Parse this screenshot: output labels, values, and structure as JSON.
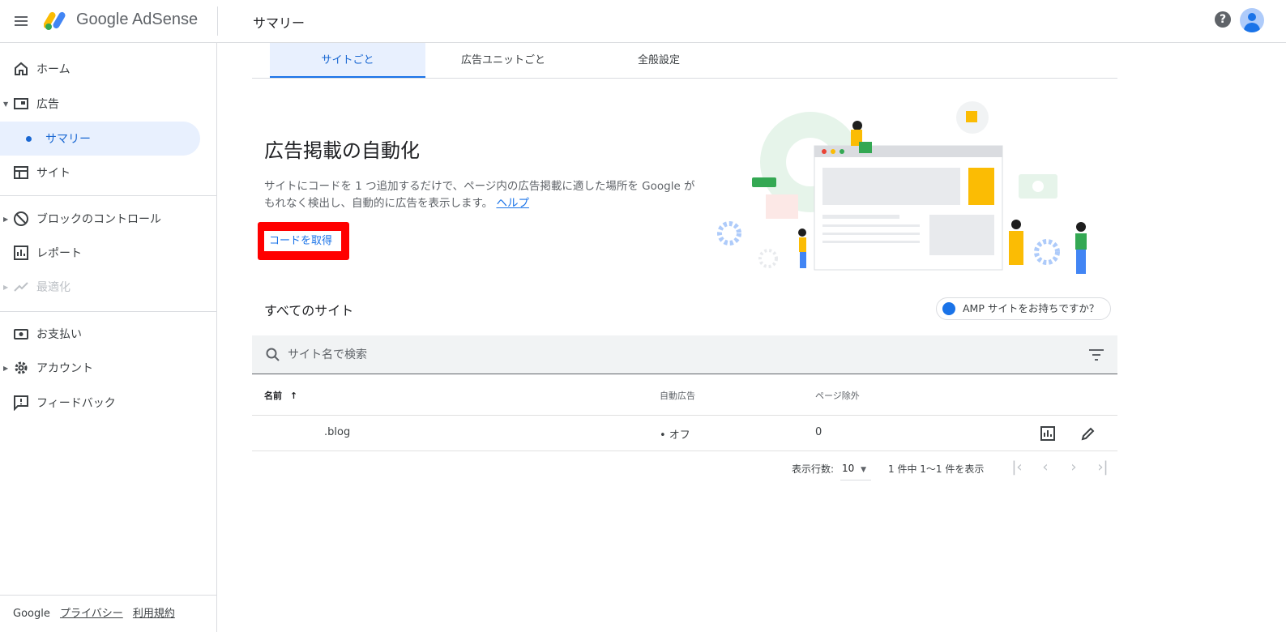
{
  "header": {
    "brand": "Google AdSense",
    "page_title": "サマリー",
    "help": "?"
  },
  "sidebar": {
    "items": [
      {
        "label": "ホーム",
        "icon": "home-icon"
      },
      {
        "label": "広告",
        "icon": "ads-icon"
      },
      {
        "label": "サマリー",
        "icon": "dot"
      },
      {
        "label": "サイト",
        "icon": "site-icon"
      },
      {
        "label": "ブロックのコントロール",
        "icon": "block-icon"
      },
      {
        "label": "レポート",
        "icon": "report-icon"
      },
      {
        "label": "最適化",
        "icon": "optimize-icon"
      },
      {
        "label": "お支払い",
        "icon": "payment-icon"
      },
      {
        "label": "アカウント",
        "icon": "gear-icon"
      },
      {
        "label": "フィードバック",
        "icon": "feedback-icon"
      }
    ],
    "footer": {
      "google": "Google",
      "privacy": "プライバシー",
      "terms": "利用規約"
    }
  },
  "tabs": [
    {
      "label": "サイトごと",
      "active": true
    },
    {
      "label": "広告ユニットごと",
      "active": false
    },
    {
      "label": "全般設定",
      "active": false
    }
  ],
  "hero": {
    "title": "広告掲載の自動化",
    "description": "サイトにコードを 1 つ追加するだけで、ページ内の広告掲載に適した場所を Google がもれなく検出し、自動的に広告を表示します。",
    "help_link": "ヘルプ",
    "get_code": "コードを取得"
  },
  "sites": {
    "title": "すべてのサイト",
    "amp_chip": "AMP サイトをお持ちですか？",
    "search_placeholder": "サイト名で検索",
    "columns": {
      "name": "名前",
      "sort": "↑",
      "auto_ads": "自動広告",
      "page_exclusions": "ページ除外"
    },
    "rows": [
      {
        "name": ".blog",
        "auto_ads": "• オフ",
        "page_exclusions": "0"
      }
    ],
    "pager": {
      "rows_label": "表示行数:",
      "rows_value": "10",
      "range": "1 件中 1～1 件を表示"
    }
  },
  "colors": {
    "accent": "#1a73e8",
    "highlight": "#ff0000",
    "active_bg": "#e8f0fe"
  }
}
